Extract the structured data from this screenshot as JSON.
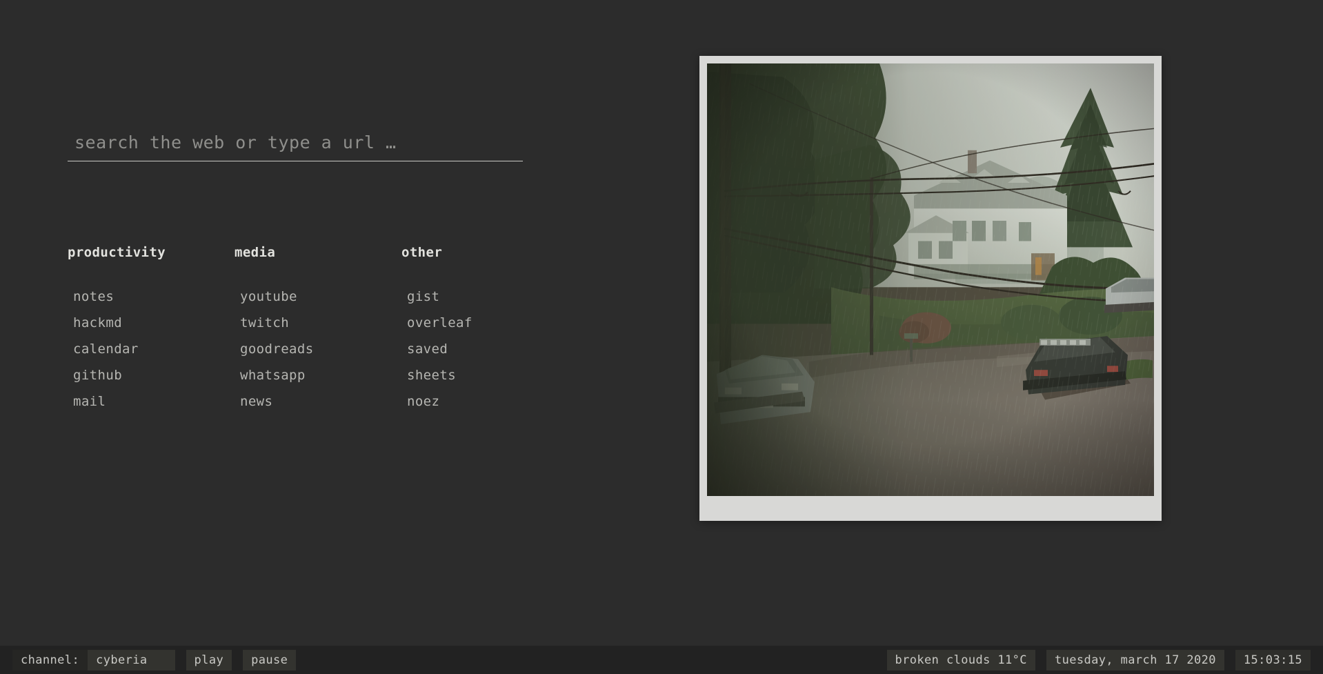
{
  "theme": {
    "background": "#2c2c2c",
    "statusbar_background": "#222222",
    "pill_background": "#33332f",
    "text_primary": "#e2e2de",
    "text_secondary": "#b6b6b2",
    "text_muted": "#8f8f8c",
    "frame_color": "#d8d8d6",
    "rule_color": "#c9c9c5"
  },
  "search": {
    "placeholder": "search the web or type a url …",
    "value": ""
  },
  "columns": [
    {
      "title": "productivity",
      "links": [
        {
          "label": "notes"
        },
        {
          "label": "hackmd"
        },
        {
          "label": "calendar"
        },
        {
          "label": "github"
        },
        {
          "label": "mail"
        }
      ]
    },
    {
      "title": "media",
      "links": [
        {
          "label": "youtube"
        },
        {
          "label": "twitch"
        },
        {
          "label": "goodreads"
        },
        {
          "label": "whatsapp"
        },
        {
          "label": "news"
        }
      ]
    },
    {
      "title": "other",
      "links": [
        {
          "label": "gist"
        },
        {
          "label": "overleaf"
        },
        {
          "label": "saved"
        },
        {
          "label": "sheets"
        },
        {
          "label": "noez"
        }
      ]
    }
  ],
  "photo": {
    "alt": "rainy suburban street seen from above, white house behind trees, power lines, parked sedan and suv in heavy rain"
  },
  "statusbar": {
    "channel_label": "channel:",
    "channel_value": "cyberia",
    "play_label": "play",
    "pause_label": "pause",
    "weather": "broken clouds 11°C",
    "date": "tuesday, march 17 2020",
    "time": "15:03:15"
  }
}
